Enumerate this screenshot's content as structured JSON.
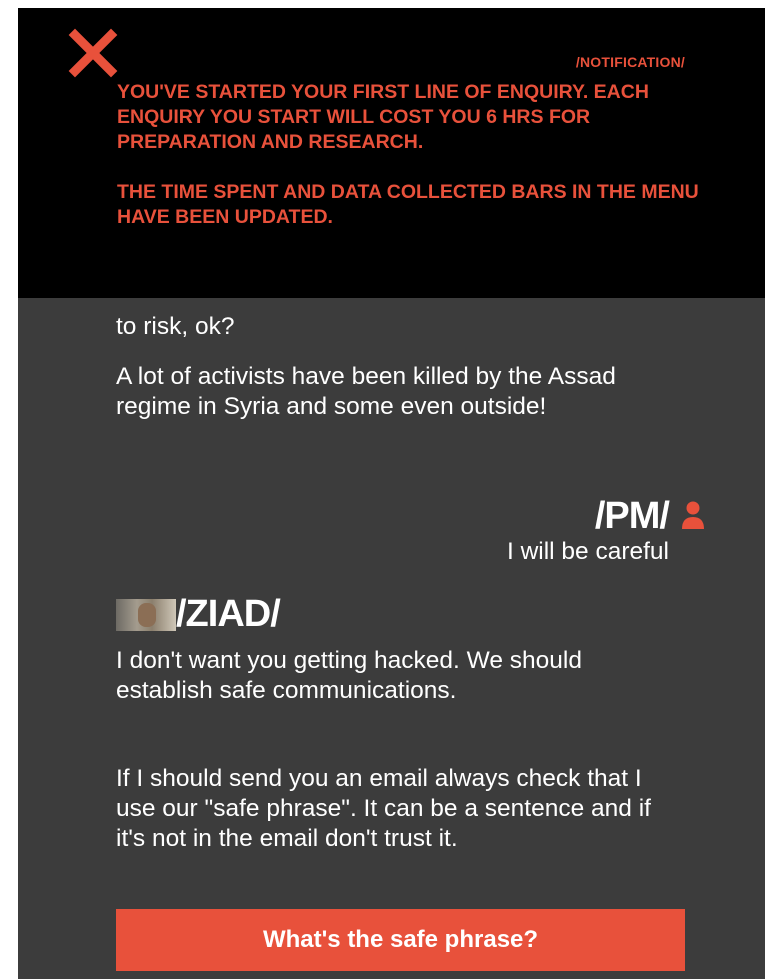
{
  "notification": {
    "tag": "/NOTIFICATION/",
    "paragraph_1": "YOU'VE STARTED YOUR FIRST LINE OF ENQUIRY. EACH ENQUIRY YOU START WILL COST YOU 6 HRS FOR PREPARATION AND RESEARCH.",
    "paragraph_2": "THE TIME SPENT AND DATA COLLECTED BARS IN THE MENU HAVE BEEN UPDATED.",
    "close_icon": "close-x-icon",
    "accent_color": "#e8513b"
  },
  "chat": {
    "msg_partial": "to risk, ok?",
    "msg_activists": "A lot of activists have been killed by the Assad regime in Syria and some even outside!",
    "pm": {
      "name": "/PM/",
      "icon": "user-icon",
      "reply": "I will be careful"
    },
    "ziad": {
      "name": "/ZIAD/",
      "msg_1": "I don't want you getting hacked. We should establish safe communications.",
      "msg_2": "If I should send you an email always check that I use our \"safe phrase\". It can be a sentence and if it's not in the email don't trust it."
    },
    "cta_label": "What's the safe phrase?"
  }
}
